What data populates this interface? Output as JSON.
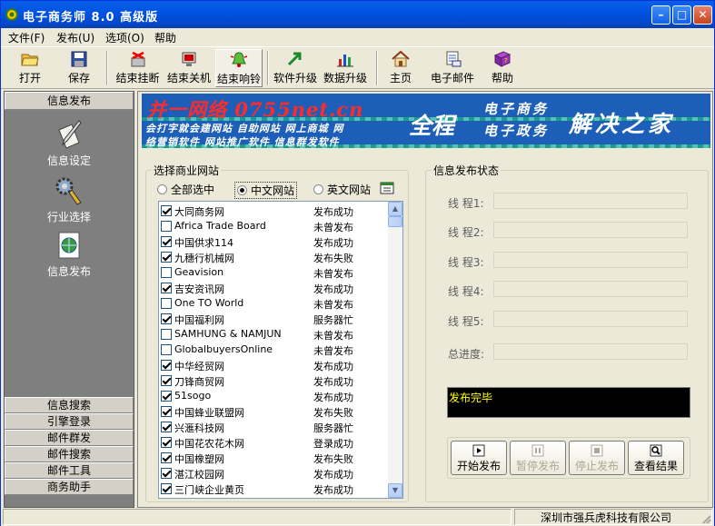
{
  "window": {
    "title": "电子商务师 8.0 高级版"
  },
  "menu": [
    "文件(F)",
    "发布(U)",
    "选项(O)",
    "帮助"
  ],
  "toolbar": [
    {
      "label": "打开",
      "icon": "folder-open-icon"
    },
    {
      "label": "保存",
      "icon": "floppy-disk-icon"
    },
    {
      "label": "结束挂断",
      "icon": "hangup-icon"
    },
    {
      "label": "结束关机",
      "icon": "shutdown-icon"
    },
    {
      "label": "结束响铃",
      "icon": "bell-icon"
    },
    {
      "label": "软件升级",
      "icon": "upgrade-arrow-icon"
    },
    {
      "label": "数据升级",
      "icon": "bar-chart-icon"
    },
    {
      "label": "主页",
      "icon": "home-icon"
    },
    {
      "label": "电子邮件",
      "icon": "email-icon"
    },
    {
      "label": "帮助",
      "icon": "help-book-icon"
    }
  ],
  "sidebar": {
    "header": "信息发布",
    "items": [
      {
        "label": "信息设定",
        "icon": "quill-paper-icon"
      },
      {
        "label": "行业选择",
        "icon": "gears-icon"
      },
      {
        "label": "信息发布",
        "icon": "globe-page-icon"
      }
    ],
    "bottom": [
      "信息搜索",
      "引擎登录",
      "邮件群发",
      "邮件搜索",
      "邮件工具",
      "商务助手"
    ]
  },
  "banner": {
    "title": "并一网络 0755net.cn",
    "line1": "会打字就会建网站 自助网站 网上商城 网",
    "line2": "络营销软件 网站推广软件 信息群发软件",
    "quancheng": "全程",
    "ec": "电子商务",
    "eg": "电子政务",
    "jiejue": "解决之家"
  },
  "sites": {
    "group_title": "选择商业网站",
    "radios": [
      {
        "label": "全部选中",
        "selected": false
      },
      {
        "label": "中文网站",
        "selected": true
      },
      {
        "label": "英文网站",
        "selected": false
      }
    ],
    "rows": [
      {
        "name": "大同商务网",
        "status": "发布成功",
        "checked": true
      },
      {
        "name": "Africa Trade Board",
        "status": "未曾发布",
        "checked": false
      },
      {
        "name": "中国供求114",
        "status": "发布成功",
        "checked": true
      },
      {
        "name": "九穗行机械网",
        "status": "发布失败",
        "checked": true
      },
      {
        "name": "Geavision",
        "status": "未曾发布",
        "checked": false
      },
      {
        "name": "吉安资讯网",
        "status": "发布成功",
        "checked": true
      },
      {
        "name": "One TO World",
        "status": "未曾发布",
        "checked": false
      },
      {
        "name": "中国福利网",
        "status": "服务器忙",
        "checked": true
      },
      {
        "name": "SAMHUNG & NAMJUN",
        "status": "未曾发布",
        "checked": false
      },
      {
        "name": "GlobalbuyersOnline",
        "status": "未曾发布",
        "checked": false
      },
      {
        "name": "中华经贸网",
        "status": "发布成功",
        "checked": true
      },
      {
        "name": "刀锋商贸网",
        "status": "发布成功",
        "checked": true
      },
      {
        "name": "51sogo",
        "status": "发布成功",
        "checked": true
      },
      {
        "name": "中国蜂业联盟网",
        "status": "发布失败",
        "checked": true
      },
      {
        "name": "兴滙科技网",
        "status": "服务器忙",
        "checked": true
      },
      {
        "name": "中国花农花木网",
        "status": "登录成功",
        "checked": true
      },
      {
        "name": "中国橡塑网",
        "status": "发布失败",
        "checked": true
      },
      {
        "name": "湛江校园网",
        "status": "发布成功",
        "checked": true
      },
      {
        "name": "三门峡企业黄页",
        "status": "发布成功",
        "checked": true
      }
    ]
  },
  "status_panel": {
    "group_title": "信息发布状态",
    "threads": [
      "线 程1:",
      "线 程2:",
      "线 程3:",
      "线 程4:",
      "线 程5:"
    ],
    "total": "总进度:",
    "log": "发布完毕",
    "buttons": [
      {
        "label": "开始发布",
        "icon": "play-icon",
        "enabled": true
      },
      {
        "label": "暂停发布",
        "icon": "pause-icon",
        "enabled": false
      },
      {
        "label": "停止发布",
        "icon": "stop-icon",
        "enabled": false
      },
      {
        "label": "查看结果",
        "icon": "magnifier-icon",
        "enabled": true
      }
    ]
  },
  "statusbar": {
    "company": "深圳市强兵虎科技有限公司"
  }
}
